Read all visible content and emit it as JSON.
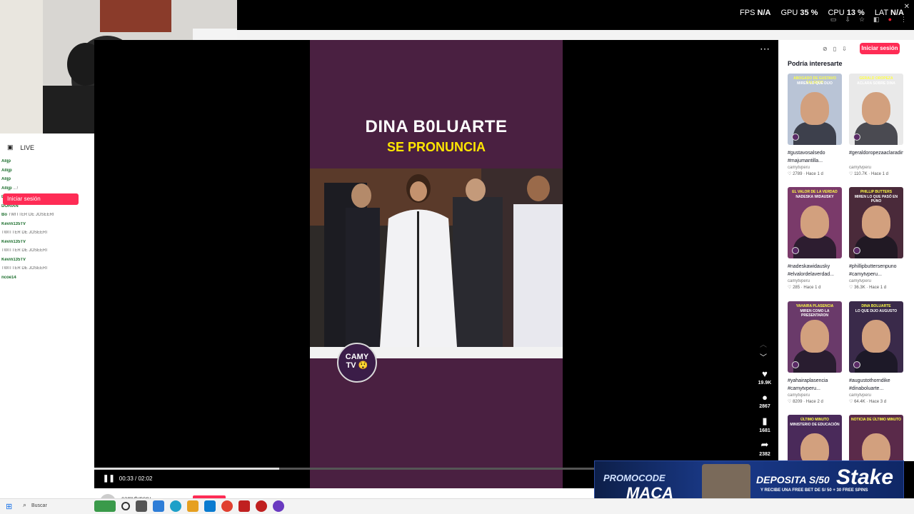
{
  "overlay": {
    "perf": [
      {
        "label": "FPS",
        "value": "N/A"
      },
      {
        "label": "GPU",
        "value": "35 %"
      },
      {
        "label": "CPU",
        "value": "13 %"
      },
      {
        "label": "LAT",
        "value": "N/A"
      }
    ]
  },
  "left_panel": {
    "live_label": "LIVE",
    "login_label": "Iniciar sesión",
    "chat": [
      {
        "user": "Alijp",
        "msg": ""
      },
      {
        "user": "Allijp",
        "msg": ""
      },
      {
        "user": "Alijp",
        "msg": ""
      },
      {
        "user": "Allijp",
        "msg": "...!"
      },
      {
        "user": "Darin_",
        "msg": ""
      },
      {
        "user": "DORIAN",
        "msg": ""
      },
      {
        "user": "Bo",
        "msg": "TWITTER DE JOSEERI"
      },
      {
        "user": "Kevin135TV",
        "msg": ""
      },
      {
        "user": "",
        "msg": "TWITTER DE JOSEERI"
      },
      {
        "user": "Kevin135TV",
        "msg": ""
      },
      {
        "user": "",
        "msg": "TWITTER DE JOSEERI"
      },
      {
        "user": "Kevin135TV",
        "msg": ""
      },
      {
        "user": "",
        "msg": "TWITTER DE JOSEERI"
      },
      {
        "user": "ncoe14",
        "msg": ""
      }
    ]
  },
  "video": {
    "headline_line1": "DINA B0LUARTE",
    "headline_line2": "SE PRONUNCIA",
    "logo_line1": "CAMY",
    "logo_line2": "TV",
    "time": "00:33 / 02:02",
    "progress": 0.27,
    "likes": "19.9K",
    "comments": "2867",
    "saves": "1681",
    "shares": "2382",
    "author": "camytvperu"
  },
  "sidebar": {
    "login_button": "Iniciar sesión",
    "title": "Podría interesarte",
    "cards": [
      {
        "desc": "#gustavosalsedo #majumantilla...",
        "author": "camytvperu",
        "likes": "2789",
        "age": "Hace 1 d",
        "thumb_title": "ABOGADO DE GUSTAVO SALSEDO",
        "thumb_sub": "MIREN LO QUE DIJO",
        "bg": "#b9c4d6"
      },
      {
        "desc": "#geraldoropezaaclaradinaboluarte...",
        "author": "camytvperu",
        "likes": "110.7K",
        "age": "Hace 1 d",
        "thumb_title": "GERALD OROPEZA",
        "thumb_sub": "ACLARA SOBRE DINA",
        "bg": "#e9e9e9"
      },
      {
        "desc": "#nadeskawidausky #elvalordelaverdad...",
        "author": "camytvperu",
        "likes": "285",
        "age": "Hace 1 d",
        "thumb_title": "EL VALOR DE LA VERDAD",
        "thumb_sub": "NADESKA WIDAUSKY",
        "bg": "#7a3a6a"
      },
      {
        "desc": "#phillipbuttersenpuno #camytvperu...",
        "author": "camytvperu",
        "likes": "36.3K",
        "age": "Hace 1 d",
        "thumb_title": "PHILLIP BUTTERS",
        "thumb_sub": "MIREN LO QUE PASÓ EN PUNO",
        "bg": "#4a2a3a"
      },
      {
        "desc": "#yahairaplasencia #camytvperu...",
        "author": "camytvperu",
        "likes": "8209",
        "age": "Hace 2 d",
        "thumb_title": "YAHAIRA PLASENCIA",
        "thumb_sub": "MIREN COMO LA PRESENTARON",
        "bg": "#6a3a6a"
      },
      {
        "desc": "#augustothorndike #dinaboluarte...",
        "author": "camytvperu",
        "likes": "64.4K",
        "age": "Hace 3 d",
        "thumb_title": "DINA BOLUARTE",
        "thumb_sub": "LO QUE DIJO AUGUSTO",
        "bg": "#3a2a4a"
      },
      {
        "desc": "",
        "author": "",
        "likes": "",
        "age": "",
        "thumb_title": "ÚLTIMO MINUTO",
        "thumb_sub": "MINISTERIO DE EDUCACIÓN",
        "bg": "#4a2a5a"
      },
      {
        "desc": "",
        "author": "",
        "likes": "",
        "age": "",
        "thumb_title": "NOTICIA DE ÚLTIMO MINUTO",
        "thumb_sub": "",
        "bg": "#5a2a4a"
      }
    ]
  },
  "ad": {
    "promo": "PROMOCODE",
    "code": "MACA",
    "deposit": "DEPOSITA S/50",
    "sub": "Y RECIBE UNA FREE BET DE S/ 50 + 30 FREE SPINS",
    "brand": "Stake"
  },
  "taskbar": {
    "search_placeholder": "Buscar"
  }
}
